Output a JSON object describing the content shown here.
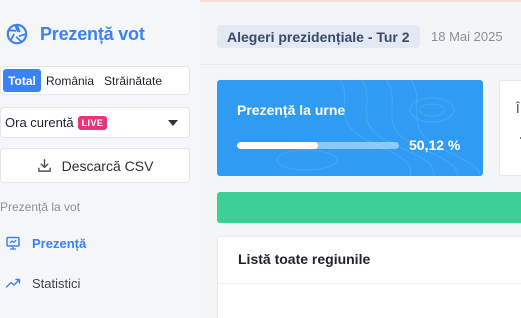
{
  "app": {
    "title": "Prezență vot",
    "brand_color": "#3b82f6",
    "icon": "aperture-logo-icon"
  },
  "sidebar": {
    "segments": [
      {
        "label": "Total",
        "active": true
      },
      {
        "label": "România",
        "active": false
      },
      {
        "label": "Străinătate",
        "active": false
      }
    ],
    "time_select": {
      "value": "Ora curentă",
      "badge": "LIVE",
      "badge_color": "#e8357a"
    },
    "download_button": {
      "label": "Descarcă CSV",
      "icon": "download-icon"
    },
    "section_label": "Prezență la vot",
    "nav": [
      {
        "label": "Prezență",
        "icon": "monitor-icon",
        "active": true
      },
      {
        "label": "Statistici",
        "icon": "trend-line-icon",
        "active": false
      }
    ]
  },
  "header": {
    "title": "Alegeri prezidențiale - Tur 2",
    "date": "18 Mai 2025"
  },
  "turnout_card": {
    "title": "Prezență la urne",
    "value_label": "50,12 %",
    "progress_fraction": 0.5012,
    "color": "#2f9bf3"
  },
  "side_card": {
    "peek_text": "Î"
  },
  "status_bar": {
    "color": "#3cd096"
  },
  "regions_list": {
    "title": "Listă toate regiunile"
  }
}
